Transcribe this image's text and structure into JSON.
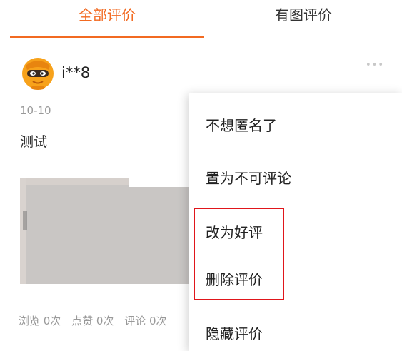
{
  "tabs": [
    {
      "label": "全部评价",
      "active": true
    },
    {
      "label": "有图评价",
      "active": false
    }
  ],
  "review": {
    "username": "i**8",
    "date": "10-10",
    "text": "测试",
    "stats": [
      "浏览 0次",
      "点赞 0次",
      "评论 0次"
    ]
  },
  "menu": {
    "items": [
      "不想匿名了",
      "置为不可评论",
      "改为好评",
      "删除评价",
      "隐藏评价"
    ]
  },
  "colors": {
    "accent": "#f26a21",
    "highlight_border": "#e0161b",
    "muted_text": "#999999"
  },
  "icons": {
    "avatar": "orange-masked-avatar-icon",
    "more": "more-dots-icon"
  }
}
